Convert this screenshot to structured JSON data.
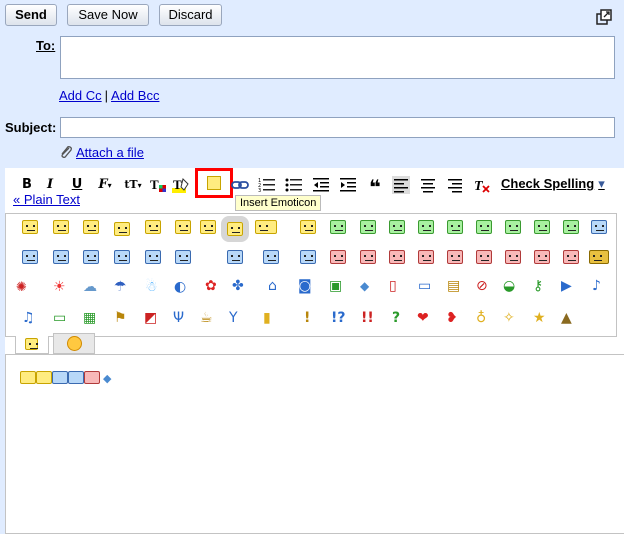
{
  "toolbar_top": {
    "send": "Send",
    "save_now": "Save Now",
    "discard": "Discard"
  },
  "fields": {
    "to_label": "To:",
    "to_value": "",
    "add_cc": "Add Cc",
    "add_bcc": "Add Bcc",
    "subject_label": "Subject:",
    "subject_value": "",
    "attach": "Attach a file"
  },
  "format_toolbar": {
    "bold": "B",
    "italic": "I",
    "underline": "U",
    "font": "F",
    "size": "tT",
    "check_spelling": "Check Spelling",
    "plain_text": "« Plain Text",
    "tooltip": "Insert Emoticon"
  },
  "colors": {
    "background": "#e0ecff",
    "highlight_box": "#ff0000",
    "link": "#0000cc"
  },
  "palette": {
    "row1_icons": [
      "smiley-yellow",
      "smiley-yellow",
      "smiley-yellow",
      "smiley-yellow",
      "smiley-yellow",
      "smiley-yellow",
      "smiley-yellow",
      "smiley-yellow",
      "smiley-yellow",
      "smiley-yellow",
      "smiley-green",
      "smiley-green",
      "smiley-green",
      "smiley-green",
      "smiley-green",
      "smiley-green",
      "smiley-green",
      "smiley-green",
      "smiley-green",
      "smiley-blue"
    ],
    "row2_icons": [
      "smiley-blue",
      "smiley-blue",
      "smiley-blue",
      "smiley-blue",
      "smiley-blue",
      "smiley-blue",
      "smiley-blue",
      "smiley-blue",
      "smiley-blue",
      "smiley-red",
      "smiley-red",
      "smiley-red",
      "smiley-red",
      "smiley-red",
      "smiley-red",
      "smiley-red",
      "smiley-red",
      "smiley-red",
      "smiley-red",
      "smiley-red"
    ],
    "row3_icons": [
      "crab-icon",
      "sun-icon",
      "cloud-icon",
      "umbrella-icon",
      "snowman-icon",
      "moon-icon",
      "flower-icon",
      "clover-icon",
      "house-icon",
      "camera-icon",
      "gift-icon",
      "eraser-icon",
      "phone-icon",
      "computer-icon",
      "bag-icon",
      "ball-icon",
      "car-icon",
      "key-icon",
      "video-camera-icon",
      "music-note-icon"
    ],
    "row4_icons": [
      "music-notes-icon",
      "tv-icon",
      "radio-icon",
      "boot-icon",
      "cake-icon",
      "fork-knife-icon",
      "coffee-icon",
      "cocktail-icon",
      "beer-icon",
      "exclamation-icon",
      "interrobang-icon",
      "double-exclamation-icon",
      "question-icon",
      "heart-icon",
      "broken-heart-icon",
      "bulb-icon",
      "sparkle-icon",
      "star-icon",
      "poop-icon"
    ]
  },
  "tabs": [
    "tab-classic-emoticons",
    "tab-new-emoticons"
  ]
}
